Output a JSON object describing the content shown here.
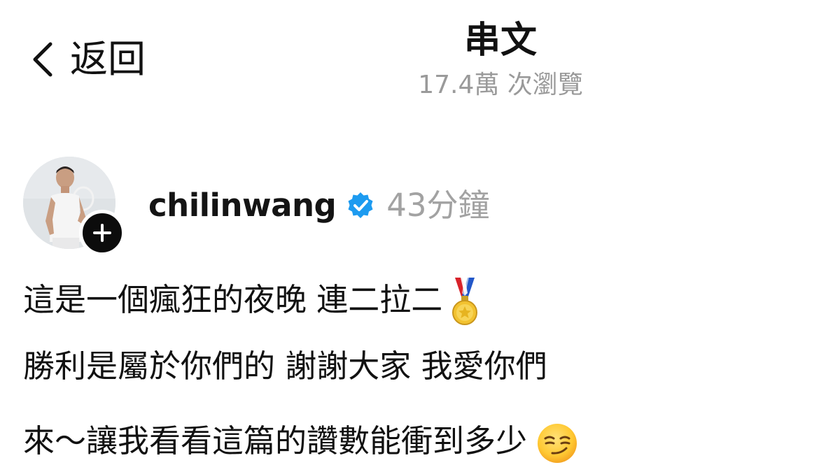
{
  "header": {
    "back_label": "返回",
    "title": "串文",
    "views": "17.4萬 次瀏覽"
  },
  "post": {
    "username": "chilinwang",
    "timestamp": "43分鐘",
    "verified": true,
    "lines": [
      "這是一個瘋狂的夜晚 連二拉二",
      "勝利是屬於你們的 謝謝大家 我愛你們",
      "來～讓我看看這篇的讚數能衝到多少"
    ],
    "line_emojis": [
      "medal-icon",
      "",
      "smirk-emoji-icon"
    ]
  },
  "colors": {
    "text_primary": "#111111",
    "text_secondary": "#9a9a9a",
    "verified_blue": "#1d9bf0",
    "follow_badge": "#0c0c0c"
  }
}
